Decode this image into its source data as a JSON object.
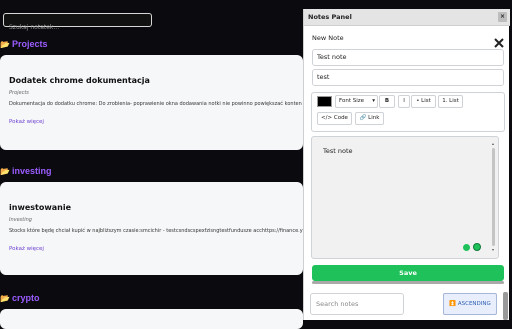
{
  "search": {
    "placeholder": "Szukaj notatek..."
  },
  "sections": [
    {
      "name": "Projects",
      "card": {
        "title": "Dodatek chrome dokumentacja",
        "category": "Projects",
        "description": "Dokumentacja do dodatku chrome: Do zrobienia- poprawienie okna dodawania notki nie powinno powiększać konten",
        "more": "Pokaż więcej"
      }
    },
    {
      "name": "investing",
      "card": {
        "title": "inwestowanie",
        "category": "Investing",
        "description": "Stocks które będę chciał kupić w najbliższym czasie:smcichir - testcsndscspexfzisngtestfundusze acchttps://finance.y",
        "more": "Pokaż więcej"
      }
    },
    {
      "name": "crypto"
    }
  ],
  "panel": {
    "title": "Notes Panel",
    "close": "×",
    "new_note_label": "New Note",
    "title_value": "Test note",
    "category_value": "test",
    "toolbar": {
      "color": "#000000",
      "font_size": "Font Size",
      "bold": "B",
      "italic": "I",
      "bullet_list": "• List",
      "numbered_list": "1. List",
      "code": "</> Code",
      "link": "🔗 Link"
    },
    "editor_content": "Test note",
    "save_label": "Save",
    "search_placeholder": "Search notes",
    "sort_label": "ASCENDING"
  }
}
